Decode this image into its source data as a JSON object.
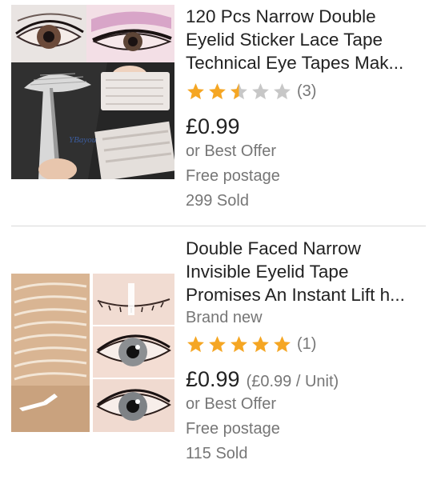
{
  "listings": [
    {
      "title_lines": [
        "120 Pcs Narrow Double",
        "Eyelid Sticker Lace Tape",
        "Technical Eye Tapes Mak..."
      ],
      "rating": 2.5,
      "rating_count": "(3)",
      "price": "£0.99",
      "offer": "or Best Offer",
      "postage": "Free postage",
      "sold": "299 Sold",
      "image_watermark": "YBayou"
    },
    {
      "title_lines": [
        "Double Faced Narrow",
        "Invisible Eyelid Tape",
        "Promises An Instant Lift h..."
      ],
      "condition": "Brand new",
      "rating": 5,
      "rating_count": "(1)",
      "price": "£0.99",
      "unit_price": "(£0.99 / Unit)",
      "offer": "or Best Offer",
      "postage": "Free postage",
      "sold": "115 Sold"
    }
  ],
  "colors": {
    "star_filled": "#f5a623",
    "star_empty": "#c7c7c7",
    "text_primary": "#222222",
    "text_secondary": "#767676"
  },
  "icons": [
    "star-icon",
    "half-star-icon"
  ]
}
